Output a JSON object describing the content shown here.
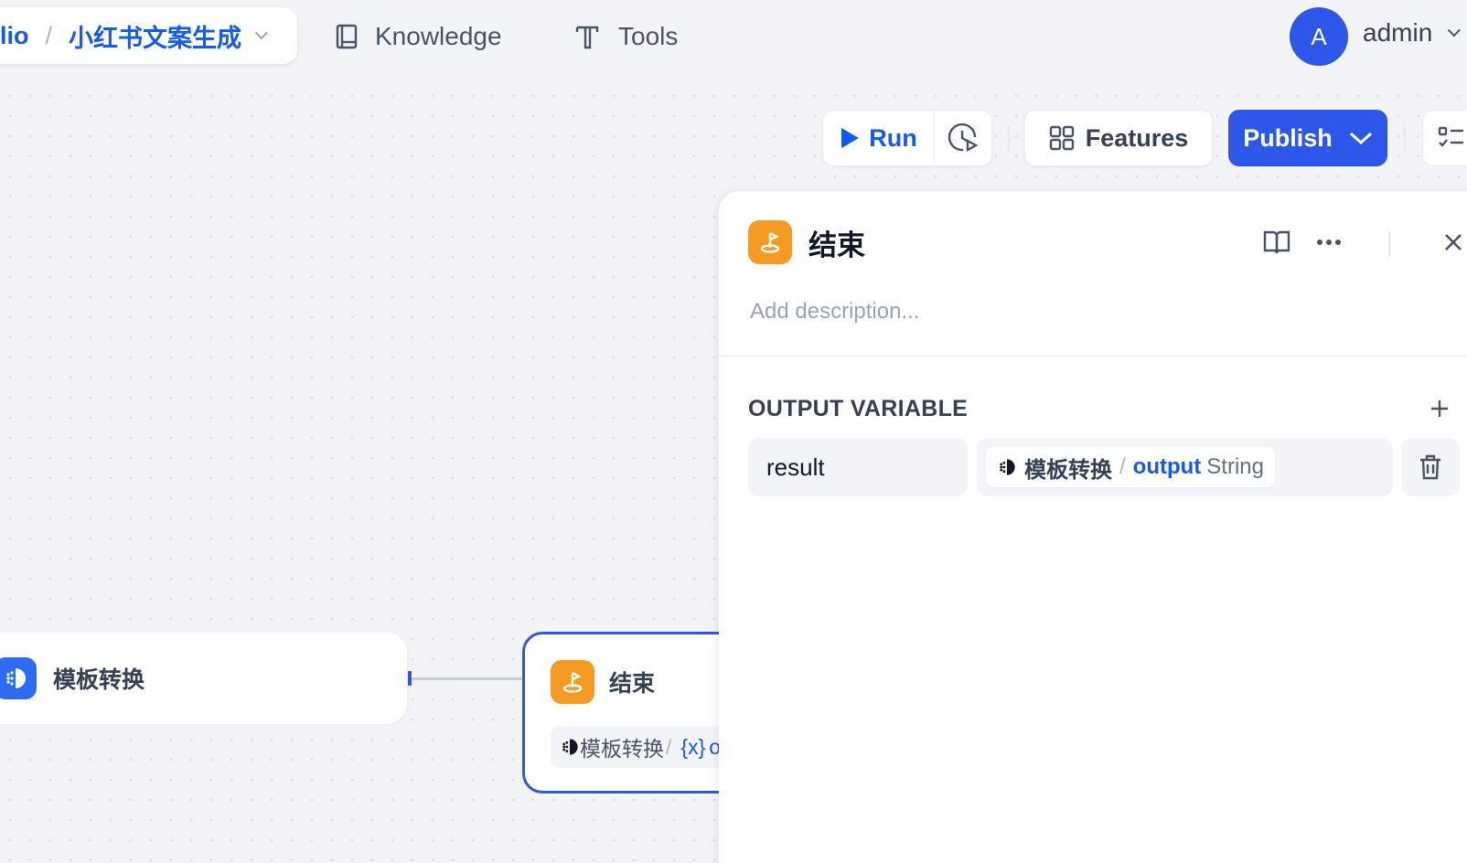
{
  "breadcrumb": {
    "studio": "lio",
    "separator": "/",
    "app_name": "小红书文案生成"
  },
  "nav": {
    "knowledge": "Knowledge",
    "tools": "Tools"
  },
  "user": {
    "avatar_letter": "A",
    "name": "admin"
  },
  "toolbar": {
    "run_label": "Run",
    "features_label": "Features",
    "publish_label": "Publish"
  },
  "nodes": {
    "template": {
      "title": "模板转换"
    },
    "end": {
      "title": "结束",
      "var_source": "模板转换",
      "var_sep": "/",
      "var_icon": "{x}",
      "var_tail": "o"
    }
  },
  "panel": {
    "title": "结束",
    "description_placeholder": "Add description...",
    "section_title": "OUTPUT VARIABLE",
    "variable": {
      "name": "result",
      "source_node": "模板转换",
      "separator": "/",
      "source_var": "output",
      "type": "String"
    }
  },
  "colors": {
    "primary": "#2d57e8",
    "link_blue": "#155aef",
    "end_node": "#f59a23",
    "template_node": "#2d6bf2"
  }
}
